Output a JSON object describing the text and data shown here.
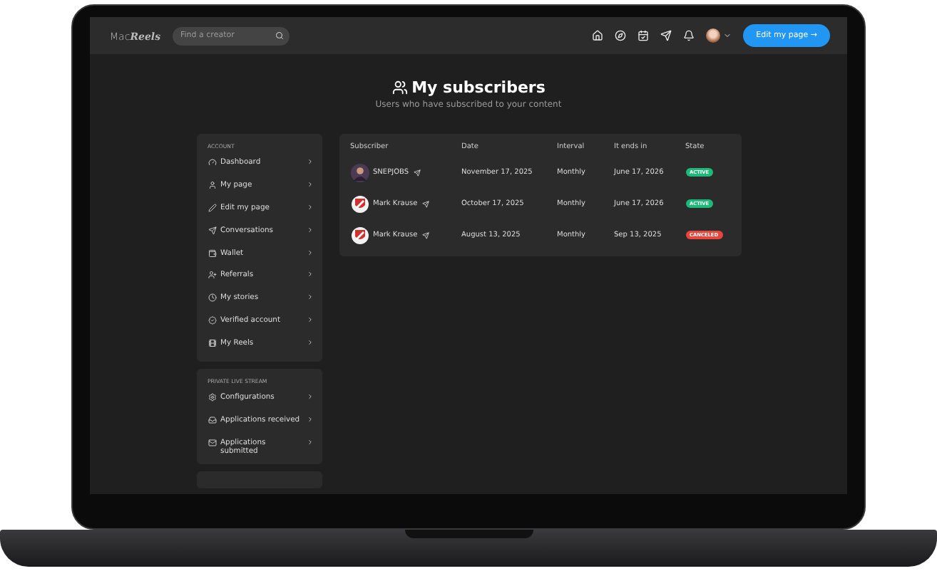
{
  "topbar": {
    "logo_prefix": "Mac",
    "logo_suffix": "Reels",
    "search": {
      "placeholder": "Find a creator"
    },
    "cta": "Edit my page →"
  },
  "header": {
    "title": "My subscribers",
    "subtitle": "Users who have subscribed to your content"
  },
  "sidebar": [
    {
      "heading": "ACCOUNT",
      "items": [
        {
          "label": "Dashboard"
        },
        {
          "label": "My page"
        },
        {
          "label": "Edit my page"
        },
        {
          "label": "Conversations"
        },
        {
          "label": "Wallet"
        },
        {
          "label": "Referrals"
        },
        {
          "label": "My stories"
        },
        {
          "label": "Verified account"
        },
        {
          "label": "My Reels"
        }
      ]
    },
    {
      "heading": "PRIVATE LIVE STREAM",
      "items": [
        {
          "label": "Configurations"
        },
        {
          "label": "Applications received"
        },
        {
          "label": "Applications submitted"
        }
      ]
    }
  ],
  "table": {
    "columns": [
      "Subscriber",
      "Date",
      "Interval",
      "It ends in",
      "State"
    ],
    "rows": [
      {
        "subscriber": "SNEPJOBS",
        "date": "November 17, 2025",
        "interval": "Monthly",
        "ends": "June 17, 2026",
        "state": "ACTIVE",
        "color": "#1db97a"
      },
      {
        "kind": "crest",
        "subscriber": "Mark Krause",
        "date": "October 17, 2025",
        "interval": "Monthly",
        "ends": "June 17, 2026",
        "state": "ACTIVE",
        "color": "#1db97a"
      },
      {
        "kind": "crest",
        "subscriber": "Mark Krause",
        "date": "August 13, 2025",
        "interval": "Monthly",
        "ends": "Sep 13, 2025",
        "state": "CANCELED",
        "color": "#e8453c"
      }
    ]
  }
}
